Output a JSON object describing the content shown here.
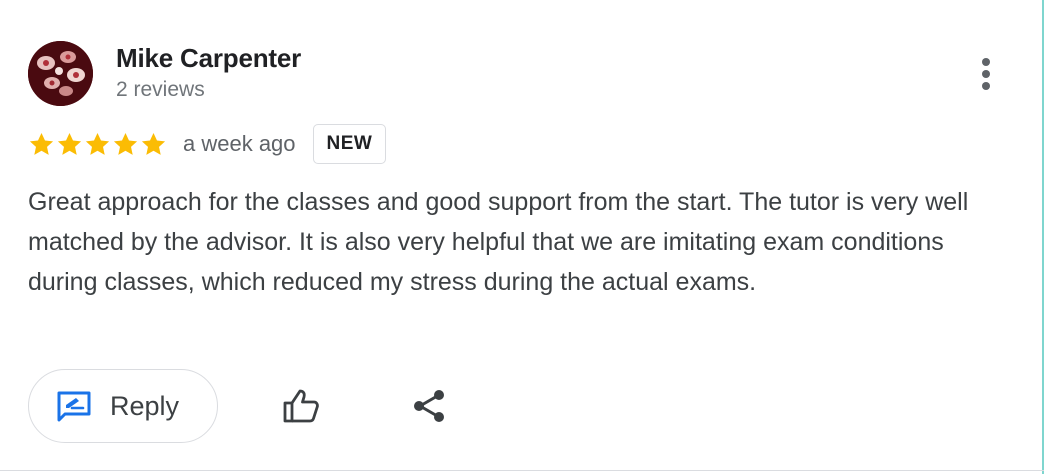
{
  "reviewer": {
    "name": "Mike Carpenter",
    "review_count": "2 reviews",
    "avatar_icon": "profile-photo"
  },
  "review": {
    "rating": 5,
    "rating_max": 5,
    "time": "a week ago",
    "badge": "NEW",
    "text": "Great approach for the classes and good support from the start. The tutor is very well matched by the advisor. It is also very helpful that we are imitating exam conditions during classes, which reduced my stress during the actual exams."
  },
  "actions": {
    "reply_label": "Reply",
    "reply_icon": "reply-edit-icon",
    "like_icon": "thumbs-up-icon",
    "share_icon": "share-icon",
    "more_icon": "more-vert-icon"
  },
  "colors": {
    "star": "#fbbc04",
    "accent_blue": "#1a73e8",
    "text": "#3c4043",
    "muted": "#70757a",
    "border": "#dadce0"
  }
}
